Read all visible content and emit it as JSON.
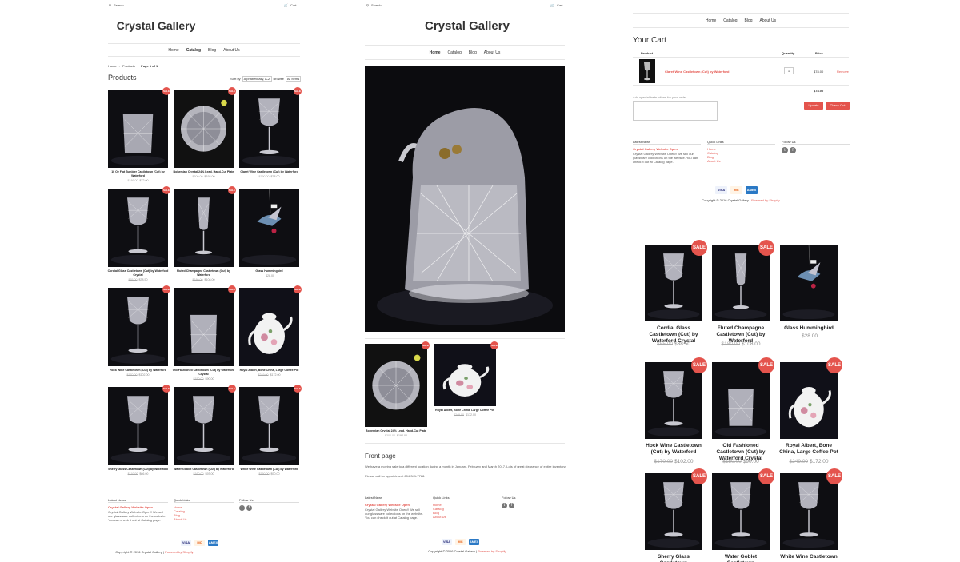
{
  "store": {
    "name": "Crystal Gallery",
    "search_label": "Search",
    "cart_label": "Cart"
  },
  "nav": [
    "Home",
    "Catalog",
    "Blog",
    "About Us"
  ],
  "catalog_page": {
    "breadcrumb": [
      "Home",
      "Products",
      "Page 1 of 1"
    ],
    "heading": "Products",
    "sort_label": "Sort by",
    "sort_value": "Alphabetically, A-Z",
    "browse_label": "Browse",
    "browse_value": "All Items",
    "products": [
      {
        "title": "10 Oz Flat Tumbler Castletown (Cut) by Waterford",
        "price_old": "$186.00",
        "price": "$72.00",
        "sale": true
      },
      {
        "title": "Bohemian Crystal 24% Lead, Hand-Cut Plate",
        "price_old": "$300.00",
        "price": "$192.00",
        "sale": true
      },
      {
        "title": "Claret Wine Castletown (Cut) by Waterford",
        "price_old": "$190.00",
        "price": "$78.00",
        "sale": true
      },
      {
        "title": "Cordial Glass Castletown (Cut) by Waterford Crystal",
        "price_old": "$55.00",
        "price": "$38.50",
        "sale": true
      },
      {
        "title": "Fluted Champagne Castletown (Cut) by Waterford",
        "price_old": "$180.00",
        "price": "$108.00",
        "sale": true
      },
      {
        "title": "Glass Hummingbird",
        "price_old": "",
        "price": "$28.00",
        "sale": false
      },
      {
        "title": "Hock Wine Castletown (Cut) by Waterford",
        "price_old": "$170.00",
        "price": "$102.00",
        "sale": true
      },
      {
        "title": "Old Fashioned Castletown (Cut) by Waterford Crystal",
        "price_old": "$150.00",
        "price": "$90.00",
        "sale": true
      },
      {
        "title": "Royal Albert, Bone China, Large Coffee Pot",
        "price_old": "$249.00",
        "price": "$172.00",
        "sale": true
      },
      {
        "title": "Sherry Glass Castletown (Cut) by Waterford",
        "price_old": "$110.00",
        "price": "$66.00",
        "sale": true
      },
      {
        "title": "Water Goblet Castletown (Cut) by Waterford",
        "price_old": "$160.00",
        "price": "$93.00",
        "sale": true
      },
      {
        "title": "White Wine Castletown (Cut) by Waterford",
        "price_old": "$150.00",
        "price": "$90.00",
        "sale": true
      }
    ]
  },
  "sale_badge": "SALE",
  "home_page": {
    "featured": [
      {
        "title": "Bohemian Crystal 24% Lead, Hand-Cut Plate",
        "price_old": "$300.00",
        "price": "$192.00"
      },
      {
        "title": "Royal Albert, Bone China, Large Coffee Pot",
        "price_old": "$249.00",
        "price": "$172.00"
      }
    ],
    "front_heading": "Front page",
    "front_text": "We have a moving sale to a different location during a month in January, February and March 2017. Lots of great clearance of entire inventory.",
    "front_call": "Please call for appointment 604-341-7788."
  },
  "cart_page": {
    "heading": "Your Cart",
    "col_product": "Product",
    "col_quantity": "Quantity",
    "col_price": "Price",
    "item_title": "Claret Wine Castletown (Cut) by Waterford",
    "item_qty": "1",
    "item_price": "$78.00",
    "remove_label": "Remove",
    "subtotal": "$78.00",
    "instructions_label": "Add special instructions for your order...",
    "update_label": "Update",
    "checkout_label": "Check Out"
  },
  "footer": {
    "news_heading": "Latest News",
    "news_title": "Crystal Gallery Website Open",
    "news_text": "Crystal Gallery Website Open!! We sell our glassware collections on the website. You can check it out at Catalog page.",
    "links_heading": "Quick Links",
    "links": [
      "Home",
      "Catalog",
      "Blog",
      "About Us"
    ],
    "follow_heading": "Follow Us",
    "copyright": "Copyright © 2016 Crystal Gallery |",
    "powered": "Powered by Shopify",
    "payments": [
      "VISA",
      "MC",
      "AMEX"
    ]
  },
  "zoom_products": [
    {
      "title": "Cordial Glass Castletown (Cut) by Waterford Crystal",
      "price_old": "$55.00",
      "price": "$38.50",
      "sale": true
    },
    {
      "title": "Fluted Champagne Castletown (Cut) by Waterford",
      "price_old": "$180.00",
      "price": "$108.00",
      "sale": true
    },
    {
      "title": "Glass Hummingbird",
      "price_old": "",
      "price": "$28.00",
      "sale": false
    },
    {
      "title": "Hock Wine Castletown (Cut) by Waterford",
      "price_old": "$170.00",
      "price": "$102.00",
      "sale": true
    },
    {
      "title": "Old Fashioned Castletown (Cut) by Waterford Crystal",
      "price_old": "$150.00",
      "price": "$90.00",
      "sale": true
    },
    {
      "title": "Royal Albert, Bone China, Large Coffee Pot",
      "price_old": "$249.00",
      "price": "$172.00",
      "sale": true
    },
    {
      "title": "Sherry Glass Castletown",
      "price_old": "",
      "price": "",
      "sale": true
    },
    {
      "title": "Water Goblet Castletown",
      "price_old": "",
      "price": "",
      "sale": true
    },
    {
      "title": "White Wine Castletown",
      "price_old": "",
      "price": "",
      "sale": true
    }
  ],
  "colors": {
    "accent": "#e4544d",
    "dark": "#0f0f12"
  }
}
